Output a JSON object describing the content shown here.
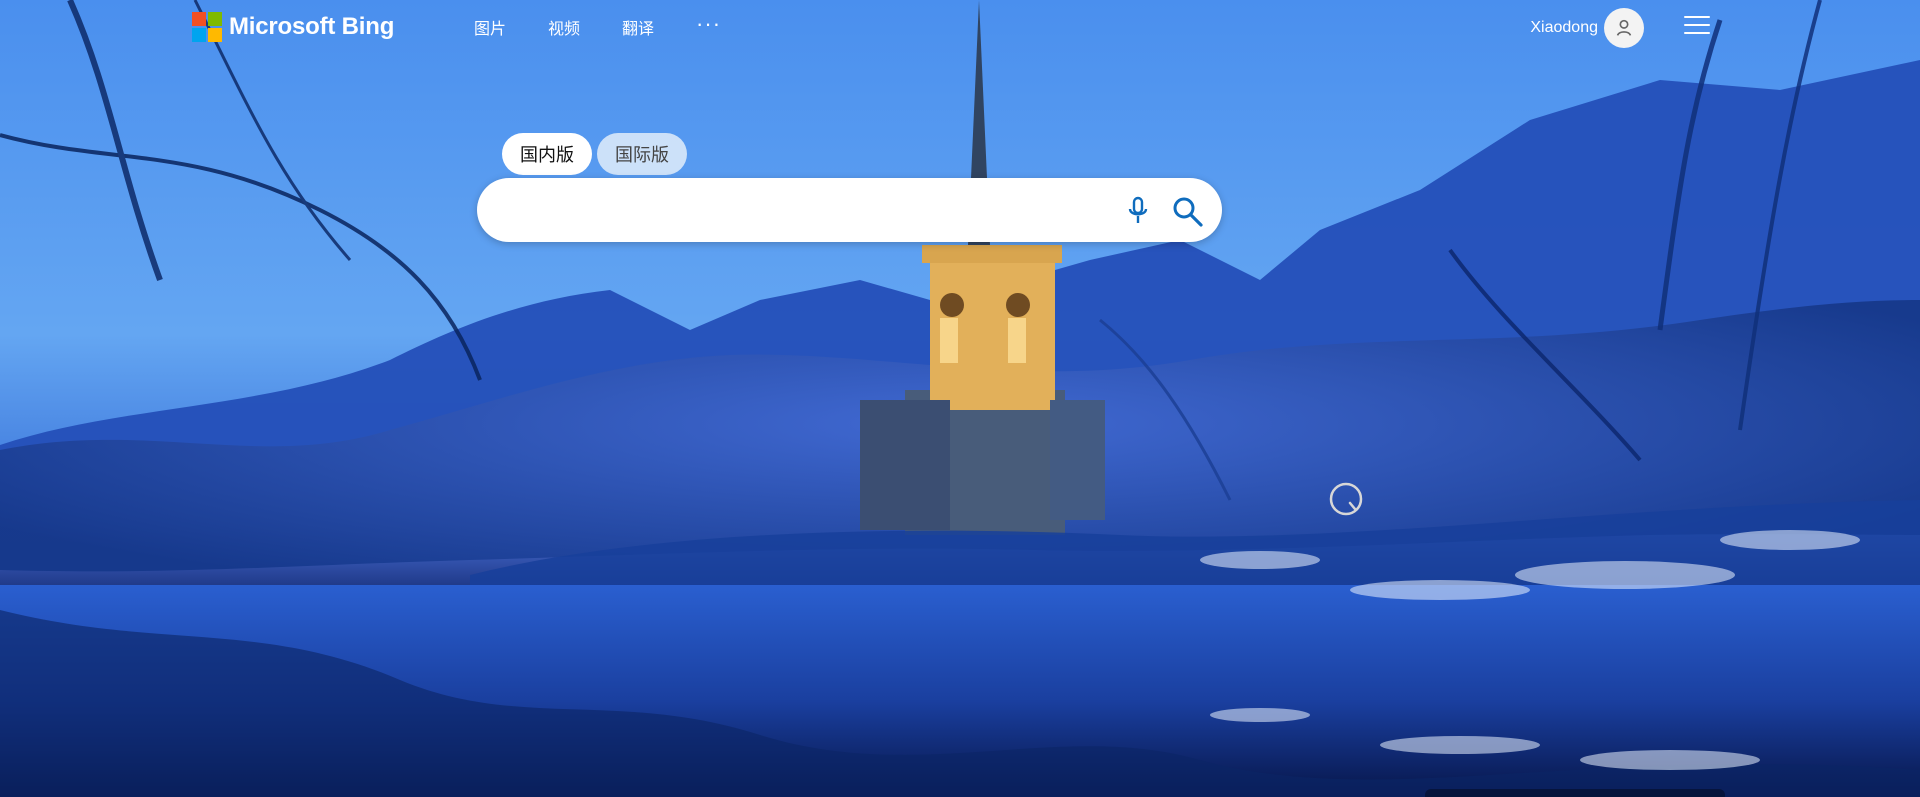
{
  "brand": {
    "name": "Microsoft Bing",
    "logo_colors": [
      "#f25022",
      "#7fba00",
      "#00a4ef",
      "#ffb900"
    ]
  },
  "nav": {
    "items": [
      "图片",
      "视频",
      "翻译"
    ],
    "more_label": "···"
  },
  "account": {
    "name": "Xiaodong"
  },
  "scope_tabs": [
    {
      "label": "国内版",
      "active": true
    },
    {
      "label": "国际版",
      "active": false
    }
  ],
  "search": {
    "placeholder": "",
    "value": ""
  },
  "icons": {
    "mic": "mic-icon",
    "search": "search-icon",
    "menu": "menu-icon",
    "avatar": "user-icon",
    "visual_search": "visual-search-icon"
  },
  "colors": {
    "accent": "#0f6cbd",
    "white": "#ffffff",
    "sky": "#4f92ea",
    "night": "#0b2461"
  }
}
